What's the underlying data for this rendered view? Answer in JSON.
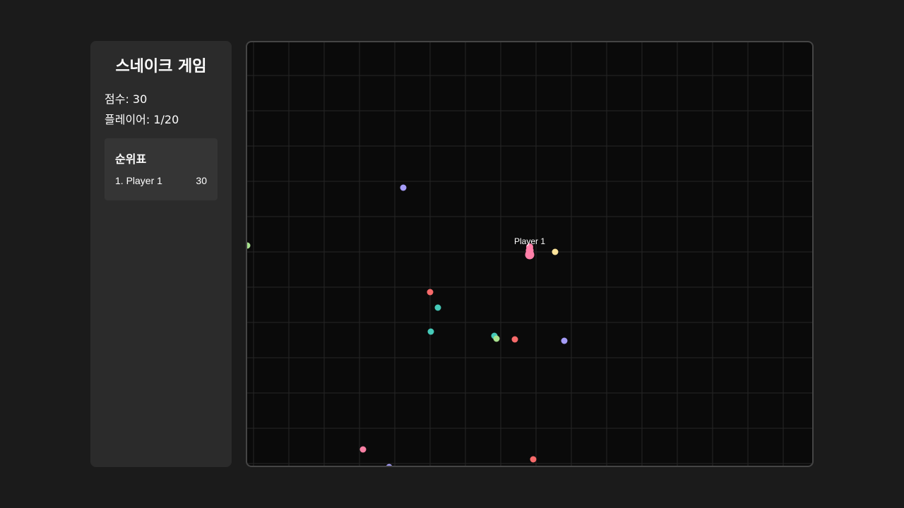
{
  "sidebar": {
    "title": "스네이크 게임",
    "score_text": "점수: 30",
    "players_text": "플레이어: 1/20",
    "leaderboard": {
      "title": "순위표",
      "entries": [
        {
          "rank_name": "1. Player 1",
          "score": "30"
        }
      ]
    }
  },
  "board": {
    "grid_color": "#262626",
    "player": {
      "name": "Player 1",
      "color": "#ff7fa8"
    },
    "food_colors": {
      "red": "#f76a6a",
      "teal": "#45c9b8",
      "purple": "#a59cf7",
      "green": "#a8e28f",
      "yellow": "#fbe39a",
      "pink": "#f77fa3"
    }
  }
}
